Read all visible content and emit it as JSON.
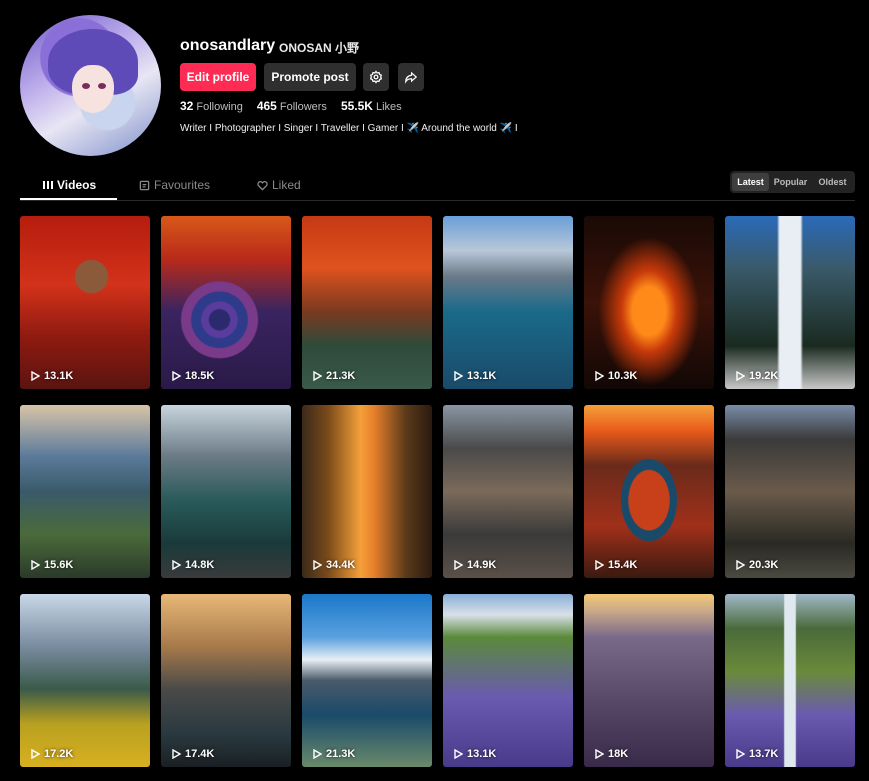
{
  "profile": {
    "username": "onosandlary",
    "nickname": "ONOSAN 小野",
    "bio": "Writer I Photographer I Singer I Traveller I Gamer I ✈️ Around the world ✈️ I",
    "stats": {
      "following_count": "32",
      "following_label": "Following",
      "followers_count": "465",
      "followers_label": "Followers",
      "likes_count": "55.5K",
      "likes_label": "Likes"
    }
  },
  "actions": {
    "edit_profile": "Edit profile",
    "promote_post": "Promote post",
    "settings_icon": "gear-icon",
    "share_icon": "share-icon"
  },
  "tabs": [
    {
      "label": "Videos",
      "icon": "grid-icon",
      "active": true
    },
    {
      "label": "Favourites",
      "icon": "bookmark-icon",
      "active": false
    },
    {
      "label": "Liked",
      "icon": "heart-icon",
      "active": false
    }
  ],
  "sort": {
    "options": [
      "Latest",
      "Popular",
      "Oldest"
    ],
    "selected": "Latest"
  },
  "videos": [
    {
      "views": "13.1K"
    },
    {
      "views": "18.5K"
    },
    {
      "views": "21.3K"
    },
    {
      "views": "13.1K"
    },
    {
      "views": "10.3K"
    },
    {
      "views": "19.2K"
    },
    {
      "views": "15.6K"
    },
    {
      "views": "14.8K"
    },
    {
      "views": "34.4K"
    },
    {
      "views": "14.9K"
    },
    {
      "views": "15.4K"
    },
    {
      "views": "20.3K"
    },
    {
      "views": "17.2K"
    },
    {
      "views": "17.4K"
    },
    {
      "views": "21.3K"
    },
    {
      "views": "13.1K"
    },
    {
      "views": "18K"
    },
    {
      "views": "13.7K"
    }
  ],
  "colors": {
    "accent": "#fe2c55",
    "background": "#000000",
    "button": "#2f2f2f"
  }
}
